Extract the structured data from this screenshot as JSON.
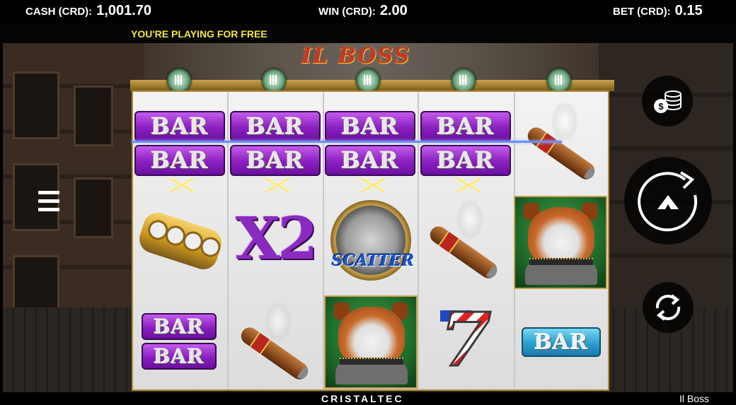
{
  "header": {
    "cash_label": "CASH (CRD):",
    "cash_value": "1,001.70",
    "win_label": "WIN (CRD):",
    "win_value": "2.00",
    "bet_label": "BET (CRD):",
    "bet_value": "0.15"
  },
  "notice": "YOU'RE PLAYING FOR FREE",
  "logo_text": "IL BOSS",
  "reels": [
    [
      "BAR-double",
      "brass-knuckles",
      "BAR-double"
    ],
    [
      "BAR-double",
      "x2",
      "cigar"
    ],
    [
      "BAR-double",
      "scatter",
      "bulldog"
    ],
    [
      "BAR-double",
      "cigar",
      "seven"
    ],
    [
      "cigar",
      "bulldog",
      "BAR-single"
    ]
  ],
  "symbols": {
    "bar_label": "BAR",
    "x2_label": "X2",
    "scatter_label": "SCATTER",
    "seven_label": "7"
  },
  "controls": {
    "bet_coins_icon": "coins-dollar-icon",
    "spin_icon": "spin-arrow-icon",
    "autoplay_icon": "autoplay-cycle-icon",
    "menu_icon": "hamburger-menu-icon"
  },
  "footer": {
    "brand": "CRISTALTEC",
    "game_name": "Il Boss"
  },
  "colors": {
    "notice": "#f3e53a",
    "payline": "#6f8cf0",
    "bar_purple": "#8a1fc0",
    "bar_blue": "#2b9fd0",
    "frame_gold": "#c9a24a"
  }
}
